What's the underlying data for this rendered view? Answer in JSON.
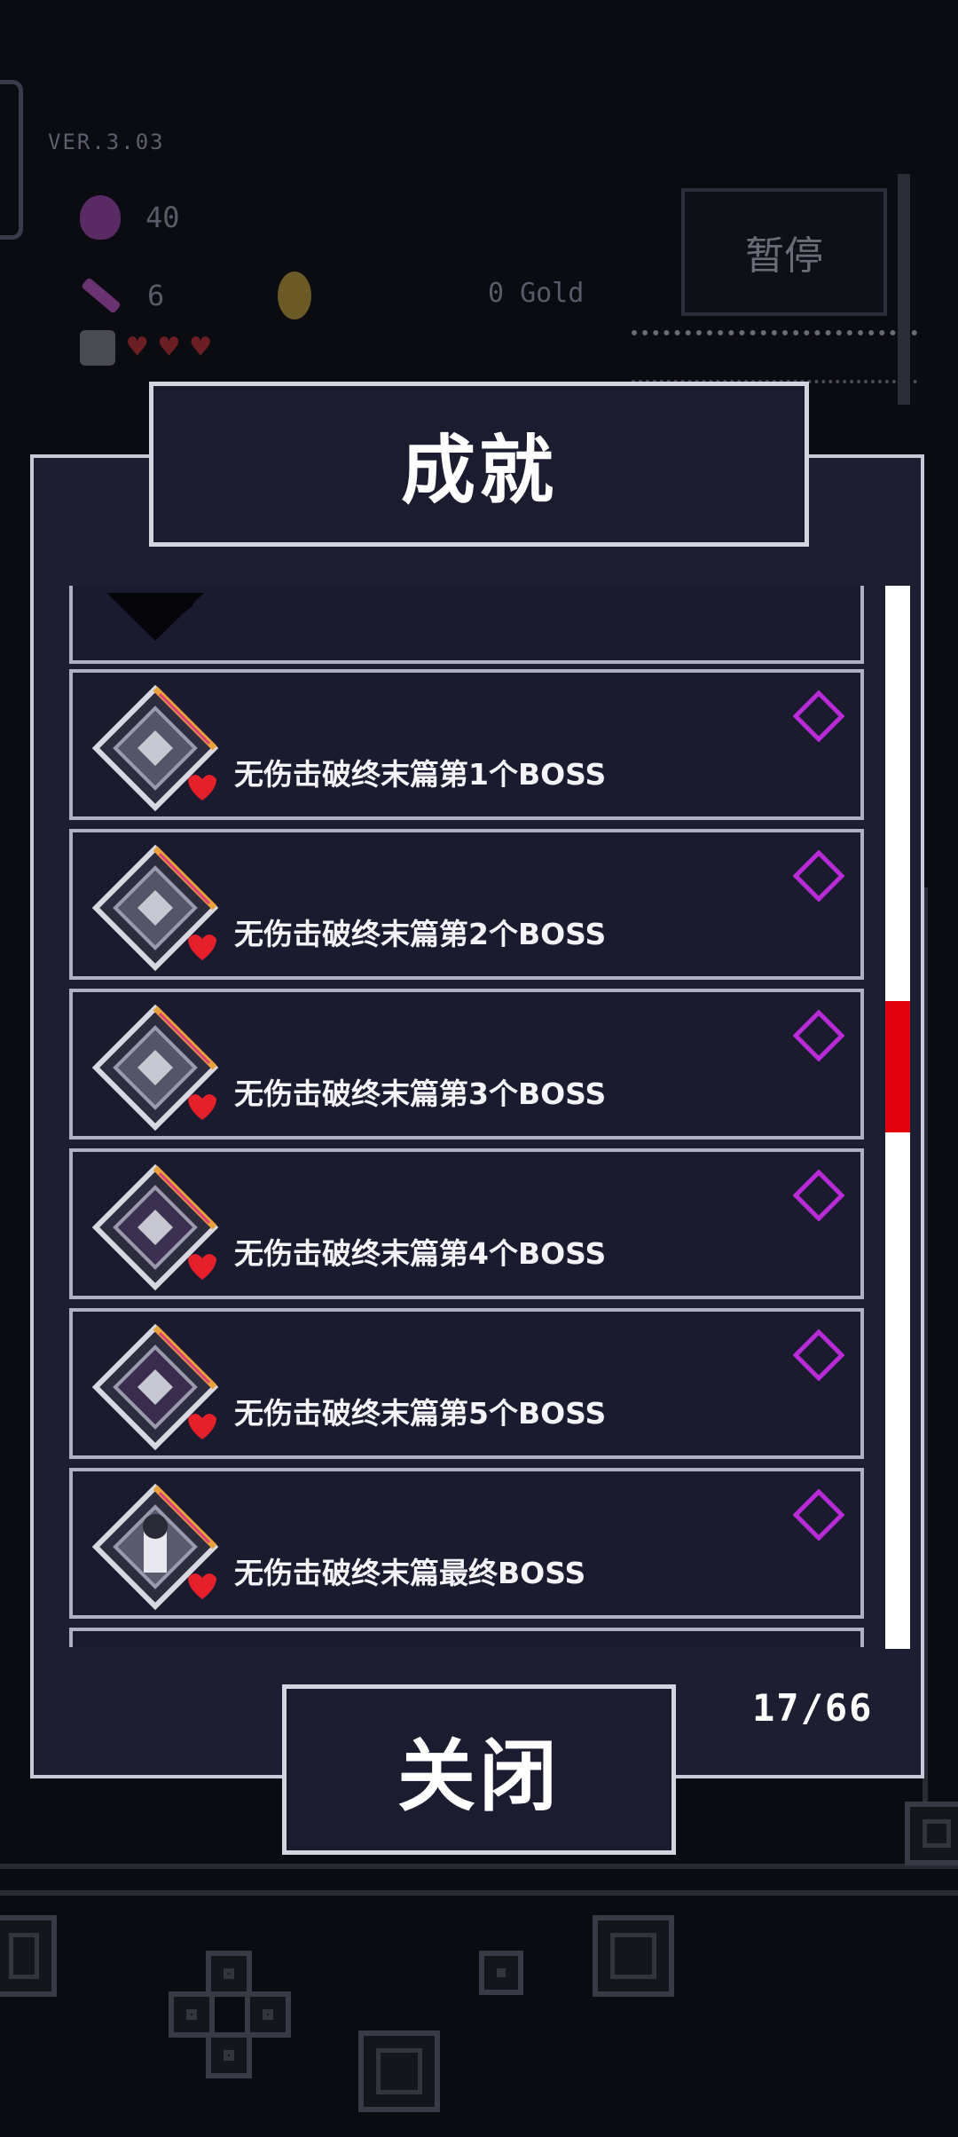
{
  "background": {
    "version": "VER.3.03",
    "potion_count": "40",
    "wand_count": "6",
    "gold": "0  Gold",
    "pause_label": "暂停",
    "hearts": 3
  },
  "dialog": {
    "title": "成就",
    "close_label": "关闭",
    "progress": "17/66",
    "scroll_position": 0.42
  },
  "achievements": [
    {
      "label": "??????????????",
      "partial": "top",
      "unlocked": false
    },
    {
      "label": "无伤击破终末篇第1个BOSS",
      "unlocked": false
    },
    {
      "label": "无伤击破终末篇第2个BOSS",
      "unlocked": false
    },
    {
      "label": "无伤击破终末篇第3个BOSS",
      "unlocked": false
    },
    {
      "label": "无伤击破终末篇第4个BOSS",
      "unlocked": false
    },
    {
      "label": "无伤击破终末篇第5个BOSS",
      "unlocked": false
    },
    {
      "label": "无伤击破终末篇最终BOSS",
      "unlocked": false
    },
    {
      "label": "",
      "partial": "bottom",
      "unlocked": false
    }
  ],
  "colors": {
    "panel_bg": "#1e1e32",
    "border": "#c8c8d6",
    "scroll_thumb": "#e1000e",
    "gem": "#b82bd6",
    "badge_gold": "#e9a23b",
    "badge_pink": "#e0407a",
    "heart": "#e5202a"
  }
}
